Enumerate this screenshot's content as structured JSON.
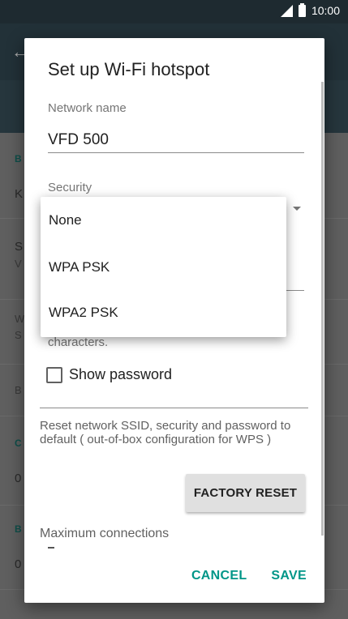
{
  "status_bar": {
    "time": "10:00",
    "icons": [
      "signal-icon",
      "battery-icon"
    ]
  },
  "background": {
    "row_letters": [
      "B",
      "K",
      "S",
      "V",
      "W",
      "S",
      "B",
      "C",
      "0",
      "B",
      "0"
    ]
  },
  "dialog": {
    "title": "Set up Wi-Fi hotspot",
    "network_name_label": "Network name",
    "network_name_value": "VFD 500",
    "security_label": "Security",
    "password_helper": "characters.",
    "show_password_label": "Show password",
    "reset_description": "Reset network SSID, security and password to default ( out-of-box configuration for WPS )",
    "factory_reset_label": "FACTORY RESET",
    "max_connections_label": "Maximum connections",
    "cancel_label": "CANCEL",
    "save_label": "SAVE"
  },
  "security_menu": {
    "options": [
      "None",
      "WPA PSK",
      "WPA2 PSK"
    ]
  },
  "colors": {
    "accent": "#009688",
    "appbar": "#223138",
    "statusbar": "#1e2a30"
  }
}
